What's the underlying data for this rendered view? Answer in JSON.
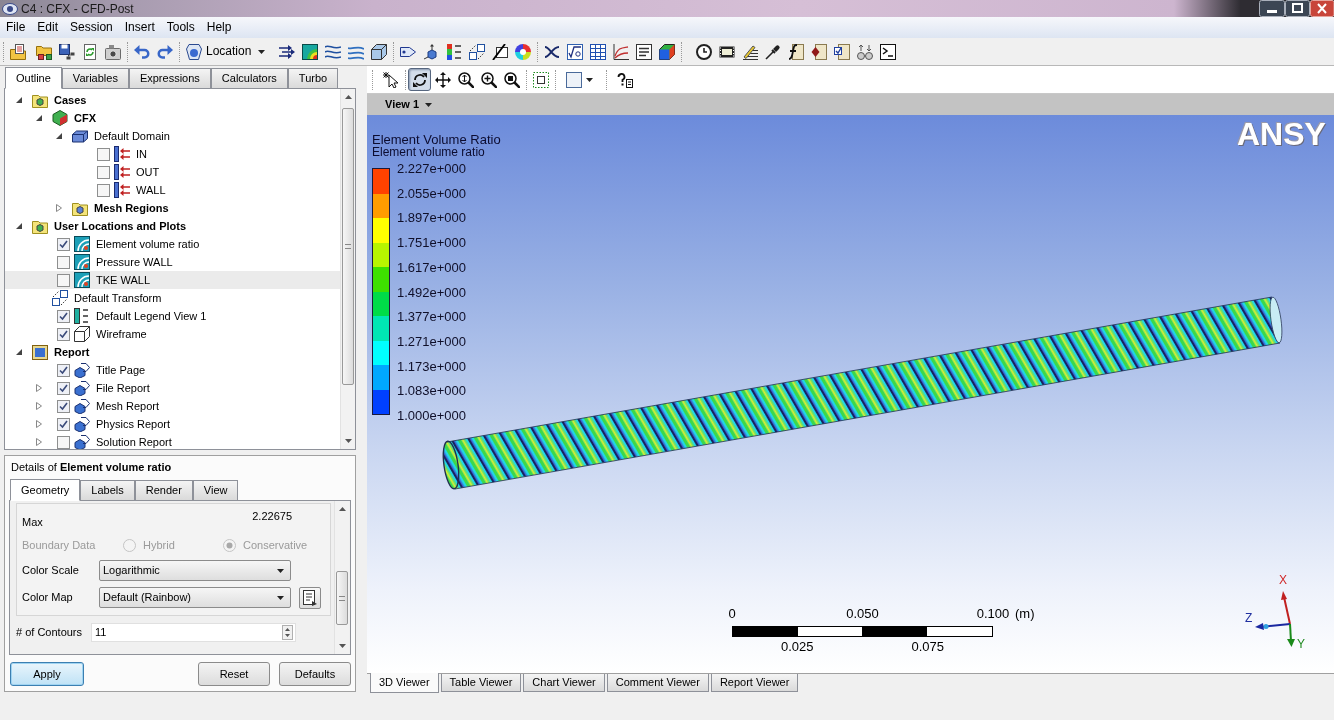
{
  "window": {
    "title": "C4 : CFX - CFD-Post"
  },
  "menu": [
    "File",
    "Edit",
    "Session",
    "Insert",
    "Tools",
    "Help"
  ],
  "toolbar": {
    "location_button": "Location"
  },
  "outline_tabs": [
    {
      "label": "Outline",
      "selected": true
    },
    {
      "label": "Variables",
      "selected": false
    },
    {
      "label": "Expressions",
      "selected": false
    },
    {
      "label": "Calculators",
      "selected": false
    },
    {
      "label": "Turbo",
      "selected": false
    }
  ],
  "outline_tree": [
    {
      "label": "Cases",
      "kind": "cases",
      "expanded": true,
      "selected": false,
      "children": [
        {
          "label": "CFX",
          "kind": "case",
          "expanded": true,
          "selected": false,
          "children": [
            {
              "label": "Default Domain",
              "kind": "domain",
              "expanded": true,
              "selected": false,
              "children": [
                {
                  "label": "IN",
                  "kind": "boundary",
                  "checked": false,
                  "selected": false
                },
                {
                  "label": "OUT",
                  "kind": "boundary",
                  "checked": false,
                  "selected": false
                },
                {
                  "label": "WALL",
                  "kind": "boundary",
                  "checked": false,
                  "selected": false
                }
              ]
            },
            {
              "label": "Mesh Regions",
              "kind": "mesh",
              "expanded": false,
              "selected": false
            }
          ]
        }
      ]
    },
    {
      "label": "User Locations and Plots",
      "kind": "group",
      "expanded": true,
      "selected": false,
      "children": [
        {
          "label": "Element volume ratio",
          "kind": "contour",
          "checked": true,
          "selected": false
        },
        {
          "label": "Pressure WALL",
          "kind": "contour",
          "checked": false,
          "selected": false
        },
        {
          "label": "TKE WALL",
          "kind": "contour",
          "checked": false,
          "selected": true
        },
        {
          "label": "Default Transform",
          "kind": "transform",
          "selected": false
        },
        {
          "label": "Default Legend View 1",
          "kind": "legend",
          "checked": true,
          "selected": false
        },
        {
          "label": "Wireframe",
          "kind": "wireframe",
          "checked": true,
          "selected": false
        }
      ]
    },
    {
      "label": "Report",
      "kind": "report",
      "expanded": true,
      "selected": false,
      "children": [
        {
          "label": "Title Page",
          "kind": "report-item",
          "checked": true,
          "selected": false
        },
        {
          "label": "File Report",
          "kind": "report-item",
          "expanded": false,
          "checked": true,
          "selected": false
        },
        {
          "label": "Mesh Report",
          "kind": "report-item",
          "expanded": false,
          "checked": true,
          "selected": false
        },
        {
          "label": "Physics Report",
          "kind": "report-item",
          "expanded": false,
          "checked": true,
          "selected": false
        },
        {
          "label": "Solution Report",
          "kind": "report-item",
          "expanded": false,
          "checked": false,
          "selected": false
        }
      ]
    }
  ],
  "details": {
    "title": "Details of **Element volume ratio**",
    "tabs": [
      {
        "label": "Geometry",
        "selected": true
      },
      {
        "label": "Labels",
        "selected": false
      },
      {
        "label": "Render",
        "selected": false
      },
      {
        "label": "View",
        "selected": false
      }
    ],
    "max": {
      "label": "Max",
      "value": "2.22675"
    },
    "boundary_data": {
      "label": "Boundary Data",
      "disabled": true,
      "options": [
        {
          "label": "Hybrid",
          "selected": false
        },
        {
          "label": "Conservative",
          "selected": true
        }
      ]
    },
    "color_scale": {
      "label": "Color Scale",
      "value": "Logarithmic"
    },
    "color_map": {
      "label": "Color Map",
      "value": "Default (Rainbow)"
    },
    "contours": {
      "label": "# of Contours",
      "value": "11"
    },
    "buttons": [
      {
        "label": "Apply",
        "default": true
      },
      {
        "label": "Reset",
        "default": false
      },
      {
        "label": "Defaults",
        "default": false
      }
    ]
  },
  "viewer": {
    "view_menu": "View 1",
    "tools": [
      {
        "kind": "select",
        "selected": false
      },
      {
        "kind": "rotate",
        "selected": true
      },
      {
        "kind": "pan",
        "selected": false
      },
      {
        "kind": "zoom",
        "selected": false
      },
      {
        "kind": "zoom-box",
        "selected": false
      }
    ],
    "logo": "ANSY",
    "legend": {
      "title": "Element Volume Ratio",
      "subtitle": "Element volume ratio",
      "labels": [
        "2.227e+000",
        "2.055e+000",
        "1.897e+000",
        "1.751e+000",
        "1.617e+000",
        "1.492e+000",
        "1.377e+000",
        "1.271e+000",
        "1.173e+000",
        "1.083e+000",
        "1.000e+000"
      ],
      "bands": [
        {
          "color": "#ff4200"
        },
        {
          "color": "#ff9c00"
        },
        {
          "color": "#ffff00"
        },
        {
          "color": "#b8f500"
        },
        {
          "color": "#3ee000"
        },
        {
          "color": "#00dc48"
        },
        {
          "color": "#00e6b4"
        },
        {
          "color": "#00ffff"
        },
        {
          "color": "#00a8ff"
        },
        {
          "color": "#0040ff"
        }
      ]
    },
    "scale_bar": {
      "top_labels": [
        "0",
        "0.050",
        "0.100"
      ],
      "unit": "(m)",
      "bottom_labels": [
        "0.025",
        "0.075"
      ]
    },
    "triad": {
      "x": "X",
      "y": "Y",
      "z": "Z"
    }
  },
  "viewer_tabs": [
    {
      "label": "3D Viewer",
      "selected": true
    },
    {
      "label": "Table Viewer",
      "selected": false
    },
    {
      "label": "Chart Viewer",
      "selected": false
    },
    {
      "label": "Comment Viewer",
      "selected": false
    },
    {
      "label": "Report Viewer",
      "selected": false
    }
  ]
}
